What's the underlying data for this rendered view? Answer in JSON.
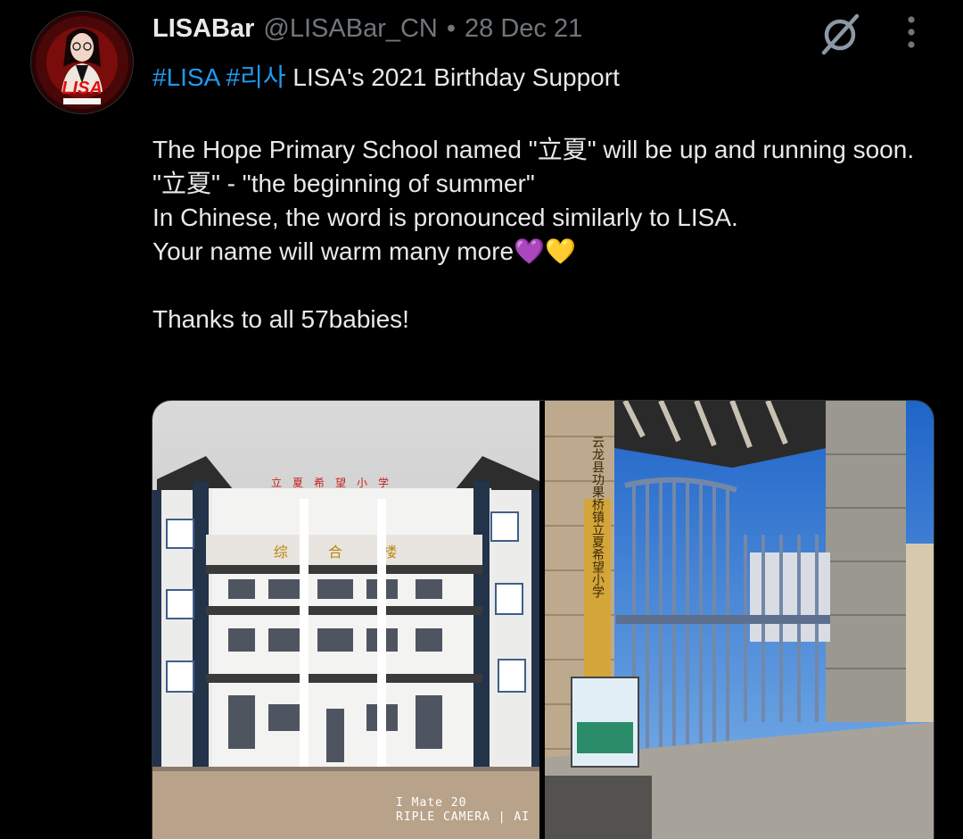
{
  "author": {
    "display_name": "LISABar",
    "handle": "@LISABar_CN",
    "separator": "•",
    "date": "28 Dec 21",
    "avatar_text": "LISA"
  },
  "tweet": {
    "hashtags": [
      "#LISA",
      "#리사"
    ],
    "title_rest": "LISA's 2021 Birthday Support",
    "line1": "The Hope Primary School named \"立夏\" will be up and running soon.",
    "line2": "\"立夏\" - \"the beginning of summer\"",
    "line3": "In Chinese, the word is pronounced similarly to LISA.",
    "line4": "Your name will warm many more💜💛",
    "line5": "Thanks to all 57babies!"
  },
  "media": {
    "left_sign": "立夏希望小学",
    "left_building_sign": "综 合 楼",
    "right_gate_sign": "云龙县功果桥镇立夏希望小学",
    "watermark_line1": "I Mate 20",
    "watermark_line2": "RIPLE CAMERA | AI"
  },
  "icons": {
    "grok": "grok-icon",
    "more": "more-vertical-icon",
    "avatar": "avatar-image"
  },
  "colors": {
    "background": "#000000",
    "text": "#e7e9ea",
    "secondary": "#71767b",
    "accent": "#1d9bf0"
  }
}
